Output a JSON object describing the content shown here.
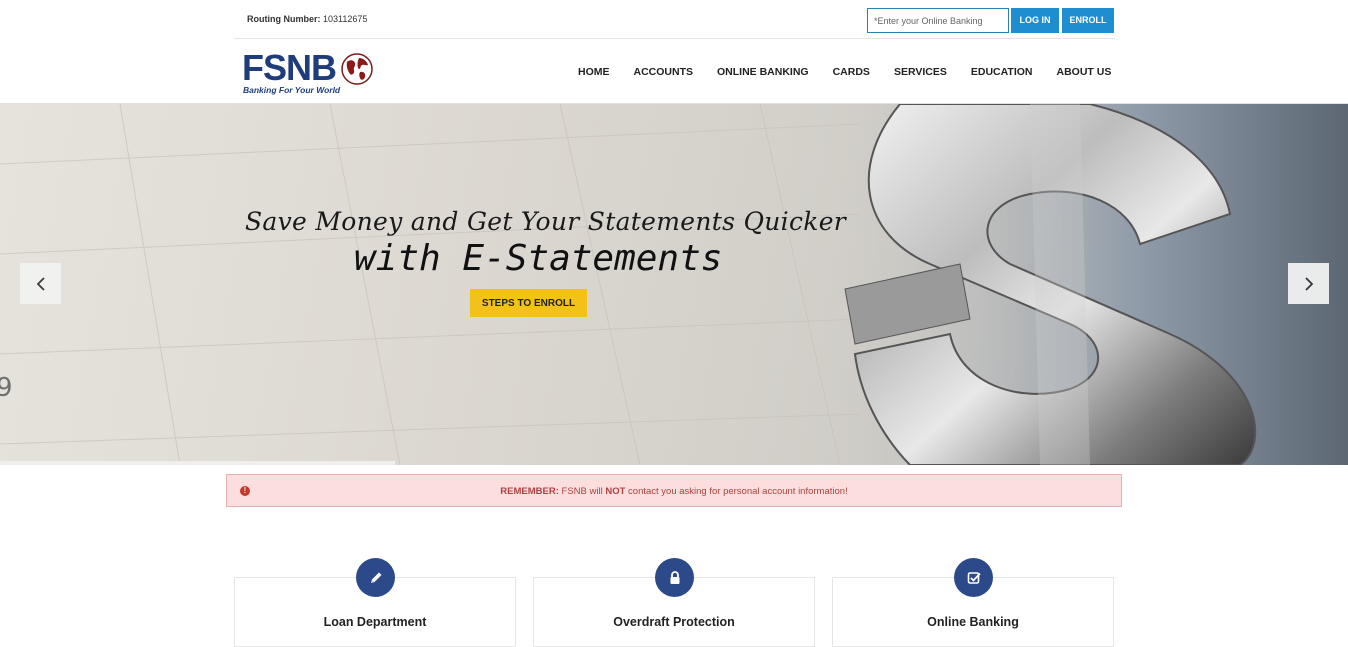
{
  "topbar": {
    "routing_label": "Routing Number:",
    "routing_value": "103112675",
    "login_placeholder": "*Enter your Online Banking",
    "login_label": "LOG IN",
    "enroll_label": "ENROLL"
  },
  "brand": {
    "name": "FSNB",
    "tagline": "Banking For Your World",
    "color": "#1f3d7a"
  },
  "nav": {
    "items": [
      "HOME",
      "ACCOUNTS",
      "ONLINE BANKING",
      "CARDS",
      "SERVICES",
      "EDUCATION",
      "ABOUT US"
    ]
  },
  "hero": {
    "line1": "Save Money and Get Your Statements Quicker",
    "line2": "with E-Statements",
    "cta": "STEPS TO ENROLL",
    "cta_color": "#f2c218",
    "background_text": "9"
  },
  "alert": {
    "prefix": "REMEMBER:",
    "text_before": " FSNB will ",
    "emphasis": "NOT",
    "text_after": " contact you asking for personal account information!"
  },
  "cards": [
    {
      "title": "Loan Department",
      "icon": "pencil-icon"
    },
    {
      "title": "Overdraft Protection",
      "icon": "lock-icon"
    },
    {
      "title": "Online Banking",
      "icon": "checkbox-icon"
    }
  ],
  "colors": {
    "accent_blue": "#1e8ed0",
    "navy": "#2c4a8a",
    "alert_bg": "#fbdedd",
    "alert_text": "#a94442"
  }
}
